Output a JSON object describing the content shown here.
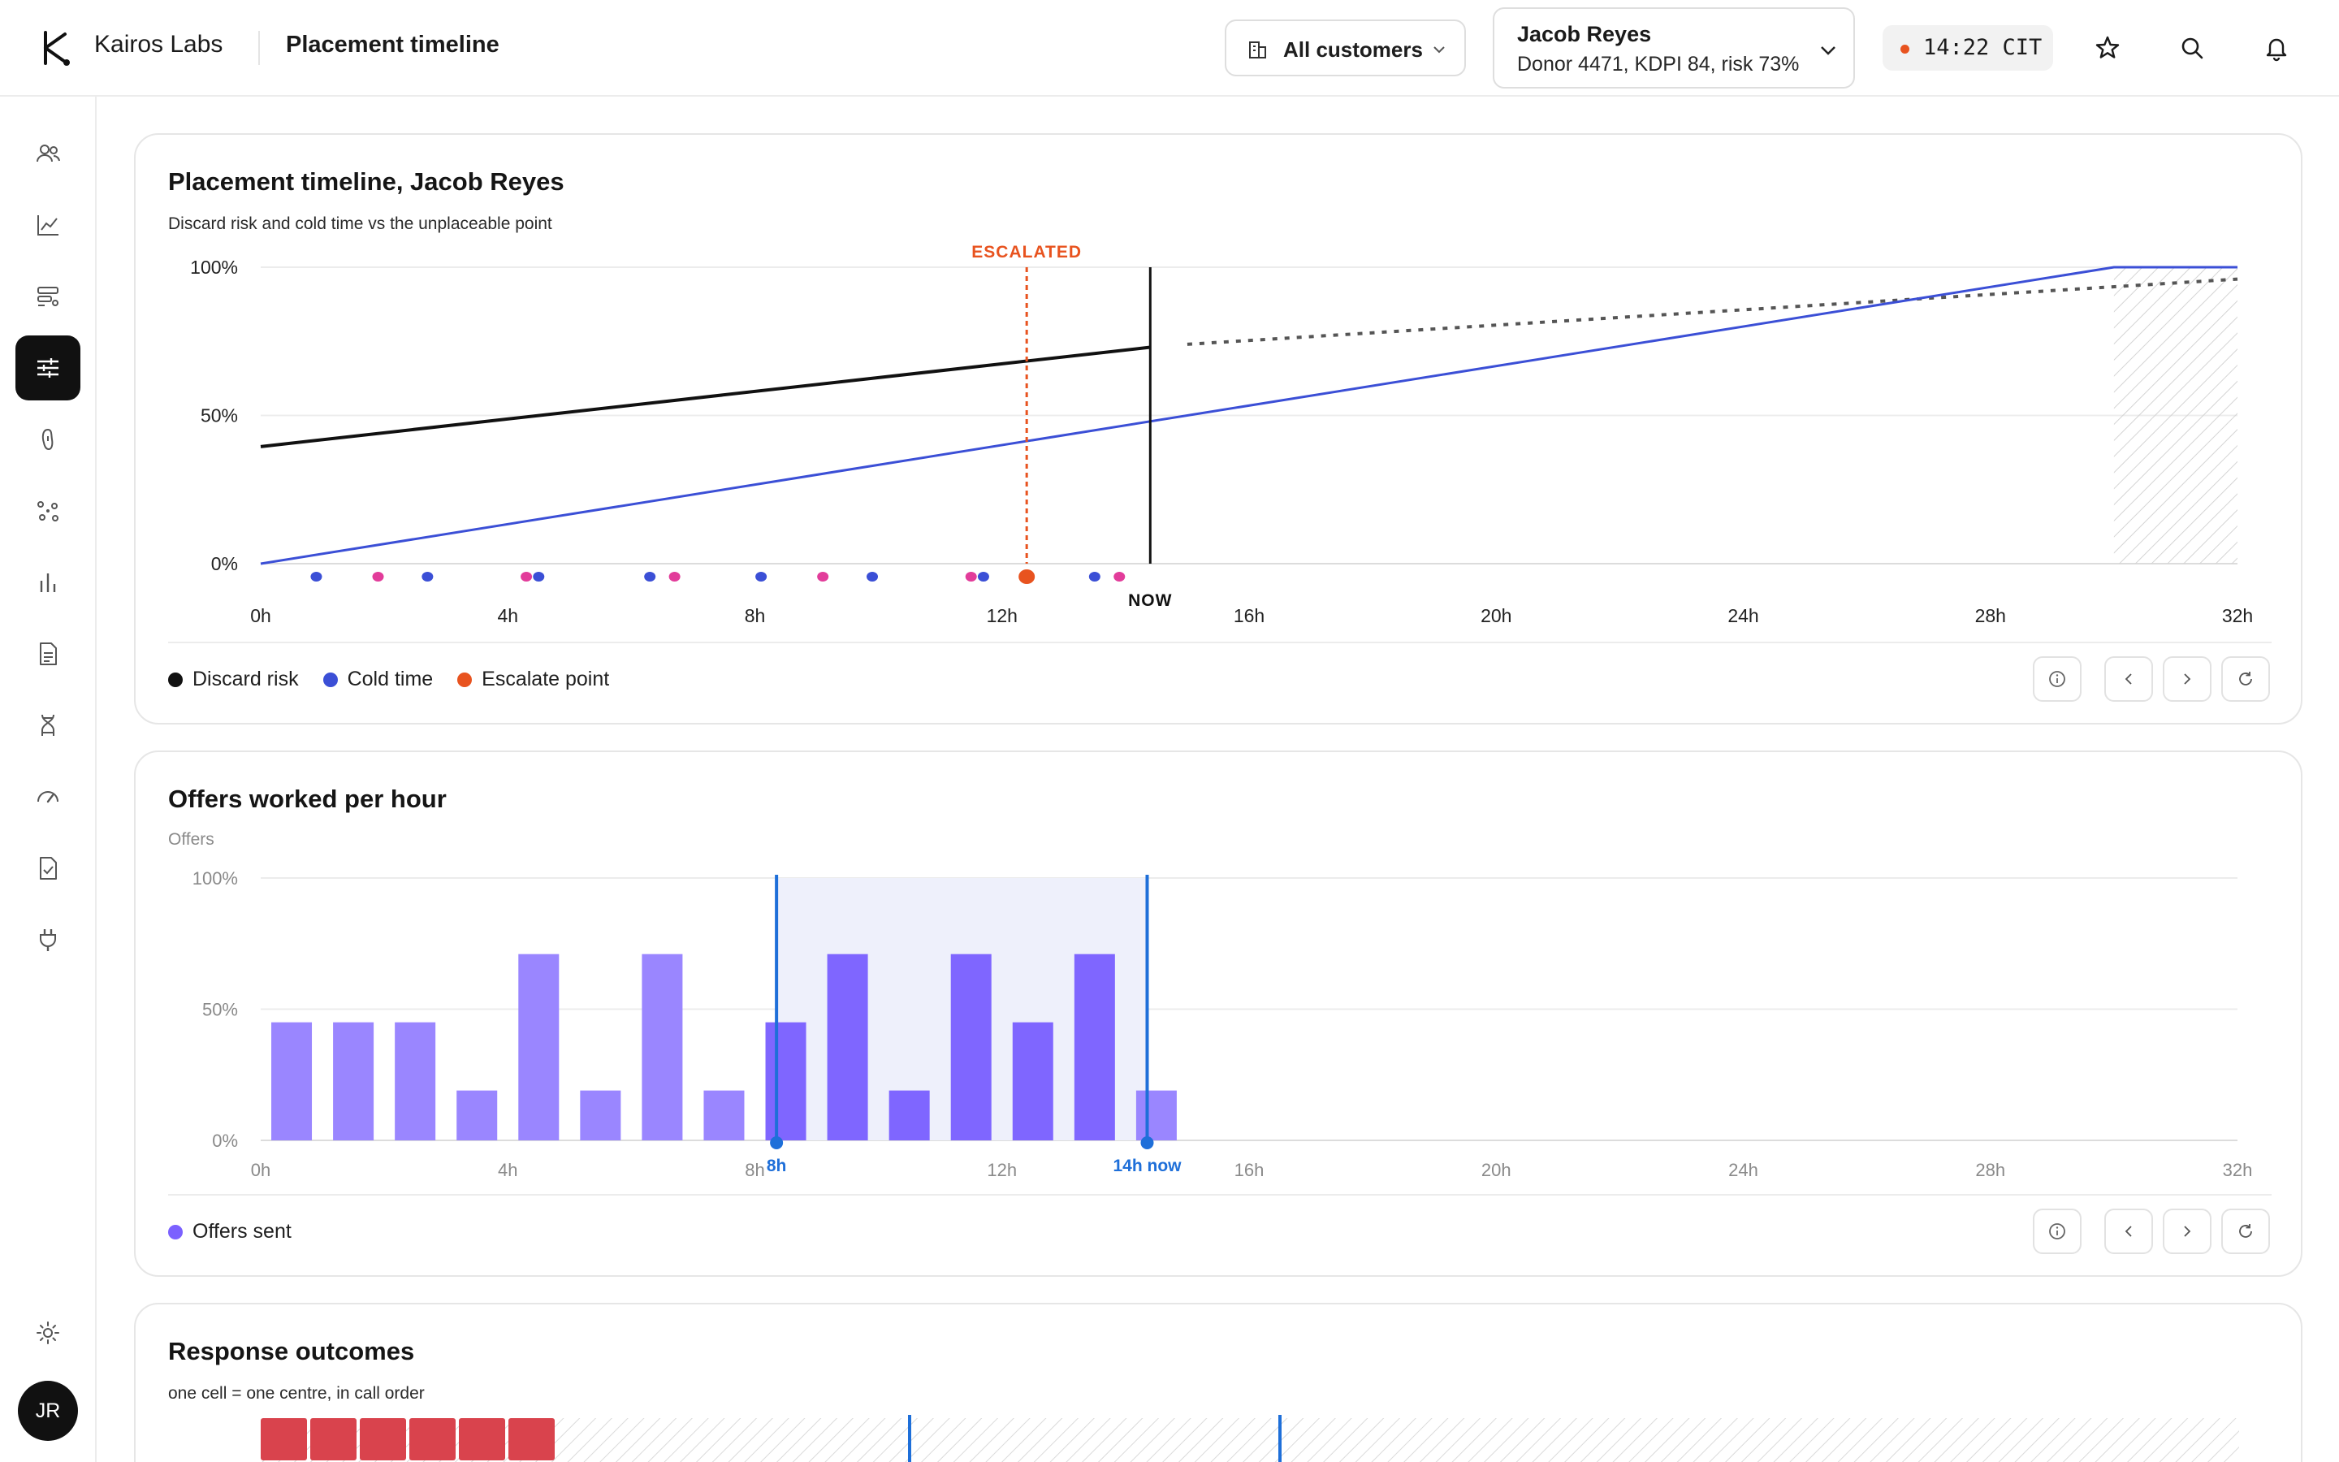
{
  "app": {
    "brand": "Kairos Labs",
    "page_title": "Placement timeline"
  },
  "header": {
    "customer_filter": "All customers",
    "donor": {
      "name": "Jacob Reyes",
      "meta": "Donor 4471, KDPI 84, risk 73%"
    },
    "clock": "14:22 CIT",
    "icons": [
      "star-icon",
      "search-icon",
      "bell-icon"
    ]
  },
  "sidebar": {
    "items": [
      {
        "icon": "people-icon"
      },
      {
        "icon": "trend-chart-icon"
      },
      {
        "icon": "stack-icon"
      },
      {
        "icon": "sliders-icon",
        "active": true
      },
      {
        "icon": "kidney-icon"
      },
      {
        "icon": "network-icon"
      },
      {
        "icon": "bar-chart-icon"
      },
      {
        "icon": "document-icon"
      },
      {
        "icon": "dna-icon"
      },
      {
        "icon": "gauge-icon"
      },
      {
        "icon": "checklist-icon"
      },
      {
        "icon": "plug-icon"
      }
    ],
    "settings_icon": "sun-settings-icon",
    "avatar_initials": "JR"
  },
  "panel_timeline": {
    "title": "Placement timeline, Jacob Reyes",
    "subtitle": "Discard risk and cold time vs the unplaceable point",
    "legend": [
      {
        "label": "Discard risk",
        "color": "#111111"
      },
      {
        "label": "Cold time",
        "color": "#3b4fd6"
      },
      {
        "label": "Escalate point",
        "color": "#e8531f"
      }
    ],
    "escalated_label": "ESCALATED",
    "now_label": "NOW",
    "controls": [
      "info-icon",
      "prev-icon",
      "next-icon",
      "refresh-icon"
    ]
  },
  "panel_offers": {
    "title": "Offers worked per hour",
    "subtitle": "Offers",
    "legend": [
      {
        "label": "Offers sent",
        "color": "#7b61ff"
      }
    ],
    "window_start_label": "8h",
    "window_end_label": "14h now",
    "controls": [
      "info-icon",
      "prev-icon",
      "next-icon",
      "refresh-icon"
    ]
  },
  "panel_outcomes": {
    "title": "Response outcomes",
    "subtitle": "one cell = one centre, in call order",
    "cells_declined": 6
  },
  "chart_data": [
    {
      "type": "line",
      "x_unit": "hours",
      "xlim": [
        0,
        32
      ],
      "ylim": [
        0,
        100
      ],
      "x_ticks": [
        "0h",
        "4h",
        "8h",
        "12h",
        "16h",
        "20h",
        "24h",
        "28h",
        "32h"
      ],
      "y_ticks": [
        "0%",
        "50%",
        "100%"
      ],
      "series": [
        {
          "name": "Discard risk",
          "color": "#111111",
          "style": "solid",
          "x": [
            0,
            14.4
          ],
          "y": [
            39.5,
            73
          ]
        },
        {
          "name": "Discard risk",
          "color": "#555555",
          "style": "dotted",
          "x": [
            15,
            32
          ],
          "y": [
            74,
            96
          ]
        },
        {
          "name": "Cold time",
          "color": "#3b4fd6",
          "style": "solid",
          "x": [
            0,
            30,
            32
          ],
          "y": [
            0,
            100,
            100
          ]
        }
      ],
      "escalate_x": 12.4,
      "now_x": 14.4,
      "unplaceable_start_x": 30,
      "events": {
        "blue": [
          0.9,
          2.7,
          4.5,
          6.3,
          8.1,
          9.9,
          11.7,
          13.5
        ],
        "pink": [
          1.9,
          4.3,
          6.7,
          9.1,
          11.5,
          13.9
        ],
        "orange": [
          12.4
        ]
      },
      "legend_position": "bottom-left",
      "grid": true
    },
    {
      "type": "bar",
      "x_unit": "hours",
      "xlim": [
        0,
        32
      ],
      "ylim": [
        0,
        100
      ],
      "x_ticks": [
        "0h",
        "4h",
        "8h",
        "12h",
        "16h",
        "20h",
        "24h",
        "28h",
        "32h"
      ],
      "y_ticks": [
        "0%",
        "50%",
        "100%"
      ],
      "categories": [
        "0h",
        "1h",
        "2h",
        "3h",
        "4h",
        "5h",
        "6h",
        "7h",
        "8h",
        "9h",
        "10h",
        "11h",
        "12h",
        "13h",
        "14h"
      ],
      "series": [
        {
          "name": "Offers sent",
          "values": [
            45,
            45,
            45,
            19,
            71,
            19,
            71,
            19,
            45,
            71,
            19,
            71,
            45,
            71,
            19
          ]
        }
      ],
      "highlight_window": [
        8.35,
        14.35
      ],
      "legend_position": "bottom-left",
      "grid": true
    }
  ]
}
